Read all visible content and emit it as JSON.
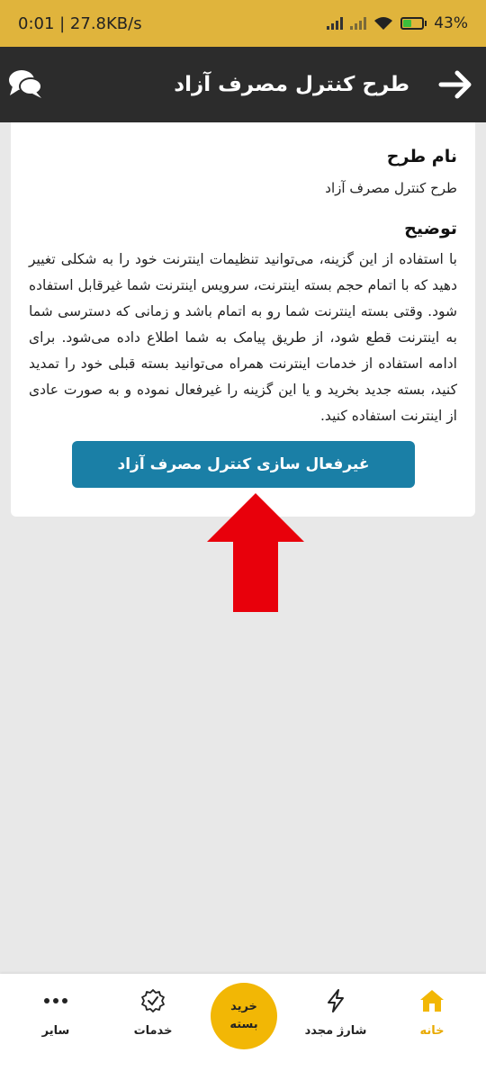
{
  "status_bar": {
    "time_speed": "0:01 | 27.8KB/s",
    "battery_percent": "43",
    "battery_level": 0.43,
    "battery_color": "#3cbf3c"
  },
  "app_bar": {
    "title": "طرح کنترل مصرف آزاد",
    "back_icon": "arrow-right-icon",
    "chat_icon": "chat-bubbles-icon"
  },
  "card": {
    "plan_label": "نام طرح",
    "plan_name": "طرح کنترل مصرف آزاد",
    "description_label": "توضیح",
    "description": "با استفاده از این گزینه، می‌توانید تنظیمات اینترنت خود را به شکلی تغییر دهید که با اتمام حجم بسته اینترنت، سرویس اینترنت شما غیرقابل استفاده شود. وقتی بسته اینترنت شما رو به اتمام باشد و زمانی که دسترسی شما به اینترنت قطع شود، از طریق پیامک به شما اطلاع داده می‌شود. برای ادامه استفاده از خدمات اینترنت همراه می‌توانید بسته قبلی خود را تمدید کنید، بسته جدید بخرید و یا این گزینه را غیرفعال نموده و به صورت عادی از اینترنت استفاده کنید.",
    "deactivate_label": "غیرفعال سازی کنترل مصرف آزاد",
    "button_color": "#1a7fa6"
  },
  "annotation": {
    "arrow_color": "#e8000b",
    "arrow_icon": "red-up-arrow-icon"
  },
  "bottom_nav": {
    "items": [
      {
        "label": "خانه",
        "icon": "home-icon",
        "active": true
      },
      {
        "label": "شارژ مجدد",
        "icon": "lightning-icon"
      },
      {
        "label": "خدمات",
        "icon": "badge-check-icon"
      },
      {
        "label": "سایر",
        "icon": "more-dots-icon"
      }
    ],
    "center_line1": "خرید",
    "center_line2": "بسته",
    "accent_color": "#f2b705"
  }
}
